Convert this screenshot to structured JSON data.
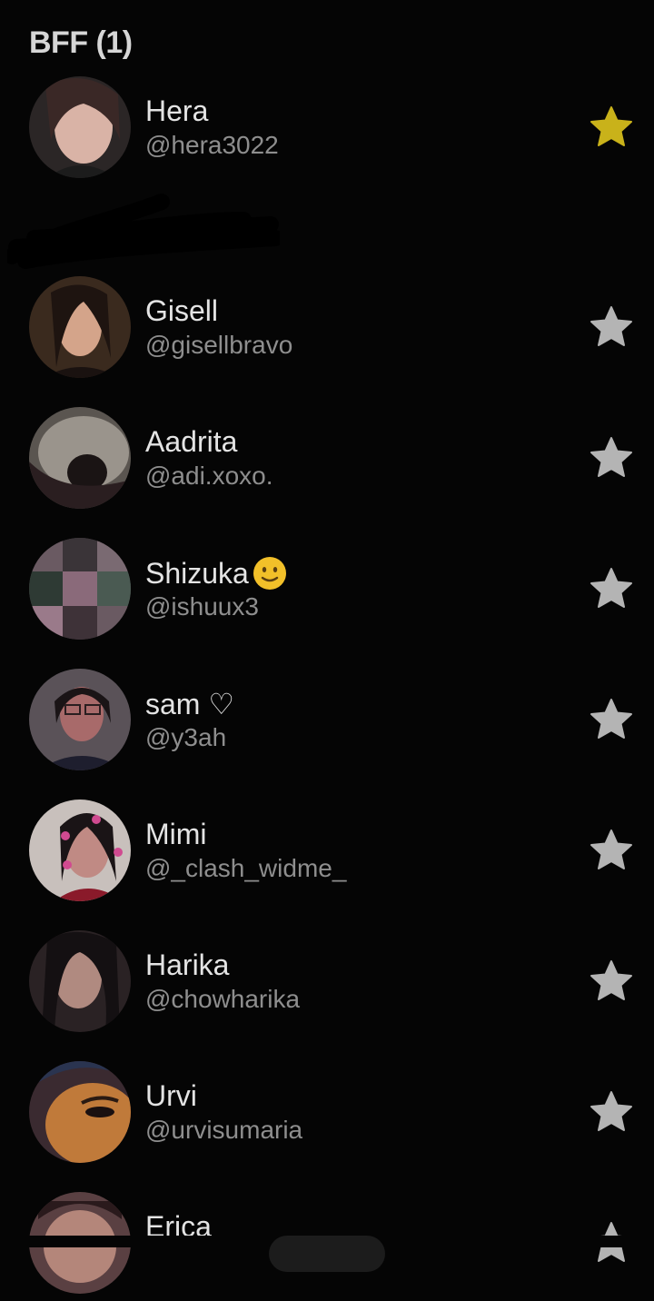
{
  "section": {
    "title": "BFF (1)"
  },
  "contacts": [
    {
      "name": "Hera",
      "handle": "@hera3022",
      "bff": true,
      "avatar_color": "#3a3030"
    },
    {
      "name": "Gisell",
      "handle": "@gisellbravo",
      "bff": false,
      "avatar_color": "#4a3226"
    },
    {
      "name": "Aadrita",
      "handle": "@adi.xoxo.",
      "bff": false,
      "avatar_color": "#7a7670"
    },
    {
      "name": "Shizuka",
      "handle": "@ishuux3",
      "bff": false,
      "avatar_color": "#5a4a52"
    },
    {
      "name": "sam ♡",
      "handle": "@y3ah",
      "bff": false,
      "avatar_color": "#6a4a50"
    },
    {
      "name": "Mimi",
      "handle": "@_clash_widme_",
      "bff": false,
      "avatar_color": "#9a7a80"
    },
    {
      "name": "Harika",
      "handle": "@chowharika",
      "bff": false,
      "avatar_color": "#3a2a28"
    },
    {
      "name": "Urvi",
      "handle": "@urvisumaria",
      "bff": false,
      "avatar_color": "#7a4a20"
    },
    {
      "name": "Erica",
      "handle": "",
      "bff": false,
      "avatar_color": "#6a4a48"
    }
  ],
  "colors": {
    "bff_star": "#c9b21a",
    "star": "#b4b4b4",
    "background": "#050505"
  },
  "icons": {
    "bff_star": "star-filled-icon",
    "star": "star-icon",
    "emoji": "slightly-smiling-face-icon"
  }
}
